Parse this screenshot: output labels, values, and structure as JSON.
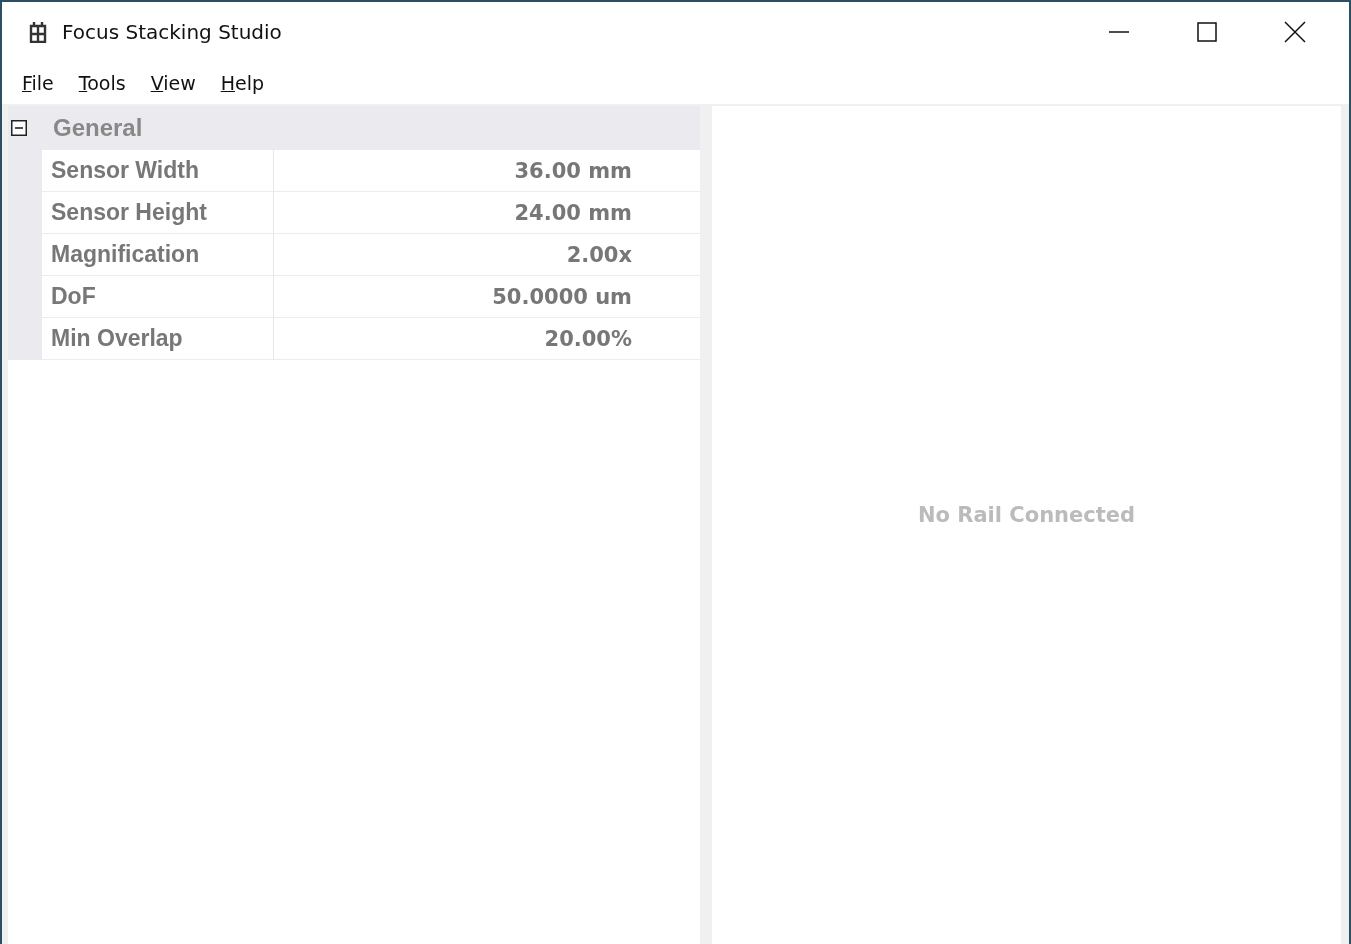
{
  "window": {
    "title": "Focus Stacking Studio"
  },
  "menu": [
    "File",
    "Tools",
    "View",
    "Help"
  ],
  "property_grid": {
    "category": "General",
    "expanded": true,
    "rows": [
      {
        "name": "Sensor Width",
        "value": "36.00 mm"
      },
      {
        "name": "Sensor Height",
        "value": "24.00 mm"
      },
      {
        "name": "Magnification",
        "value": "2.00x"
      },
      {
        "name": "DoF",
        "value": "50.0000 um"
      },
      {
        "name": "Min Overlap",
        "value": "20.00%"
      }
    ]
  },
  "rail_panel": {
    "message": "No Rail Connected"
  }
}
